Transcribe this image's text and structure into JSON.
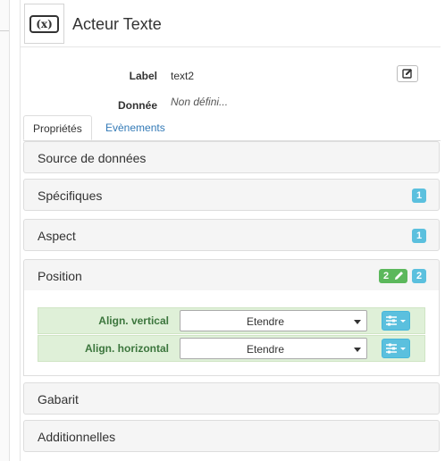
{
  "header": {
    "title": "Acteur Texte",
    "icon": "variable-icon",
    "icon_text": "(x)"
  },
  "properties": {
    "label": {
      "name": "Label",
      "value": "text2"
    },
    "data": {
      "name": "Donnée",
      "value": "Non défini..."
    }
  },
  "tabs": [
    {
      "label": "Propriétés",
      "active": true
    },
    {
      "label": "Evènements",
      "active": false
    }
  ],
  "sections": {
    "source": {
      "title": "Source de données"
    },
    "specifiques": {
      "title": "Spécifiques",
      "badge": "1"
    },
    "aspect": {
      "title": "Aspect",
      "badge": "1"
    },
    "position": {
      "title": "Position",
      "badge_modified": "2",
      "badge_count": "2",
      "rows": [
        {
          "label": "Align. vertical",
          "value": "Etendre"
        },
        {
          "label": "Align. horizontal",
          "value": "Etendre"
        }
      ]
    },
    "gabarit": {
      "title": "Gabarit"
    },
    "additionnelles": {
      "title": "Additionnelles"
    }
  },
  "colors": {
    "info_badge": "#5bc0de",
    "success_badge": "#5cb85c",
    "row_bg": "#dff0d8",
    "row_text": "#3c763d",
    "link": "#337ab7"
  }
}
